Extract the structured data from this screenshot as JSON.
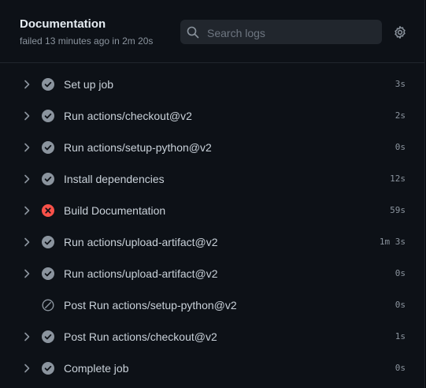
{
  "job": {
    "title": "Documentation",
    "subtitle": "failed 13 minutes ago in 2m 20s"
  },
  "search": {
    "placeholder": "Search logs"
  },
  "icons": {
    "chevron": "chevron-right-icon",
    "success": "check-circle-icon",
    "failure": "x-circle-icon",
    "skipped": "skip-icon",
    "search": "search-icon",
    "settings": "gear-icon"
  },
  "colors": {
    "success": "#8b949e",
    "failure": "#f85149",
    "text": "#c9d1d9",
    "muted": "#8b949e"
  },
  "steps": [
    {
      "name": "Set up job",
      "duration": "3s",
      "status": "success",
      "expandable": true
    },
    {
      "name": "Run actions/checkout@v2",
      "duration": "2s",
      "status": "success",
      "expandable": true
    },
    {
      "name": "Run actions/setup-python@v2",
      "duration": "0s",
      "status": "success",
      "expandable": true
    },
    {
      "name": "Install dependencies",
      "duration": "12s",
      "status": "success",
      "expandable": true
    },
    {
      "name": "Build Documentation",
      "duration": "59s",
      "status": "failure",
      "expandable": true
    },
    {
      "name": "Run actions/upload-artifact@v2",
      "duration": "1m 3s",
      "status": "success",
      "expandable": true
    },
    {
      "name": "Run actions/upload-artifact@v2",
      "duration": "0s",
      "status": "success",
      "expandable": true
    },
    {
      "name": "Post Run actions/setup-python@v2",
      "duration": "0s",
      "status": "skipped",
      "expandable": false
    },
    {
      "name": "Post Run actions/checkout@v2",
      "duration": "1s",
      "status": "success",
      "expandable": true
    },
    {
      "name": "Complete job",
      "duration": "0s",
      "status": "success",
      "expandable": true
    }
  ]
}
